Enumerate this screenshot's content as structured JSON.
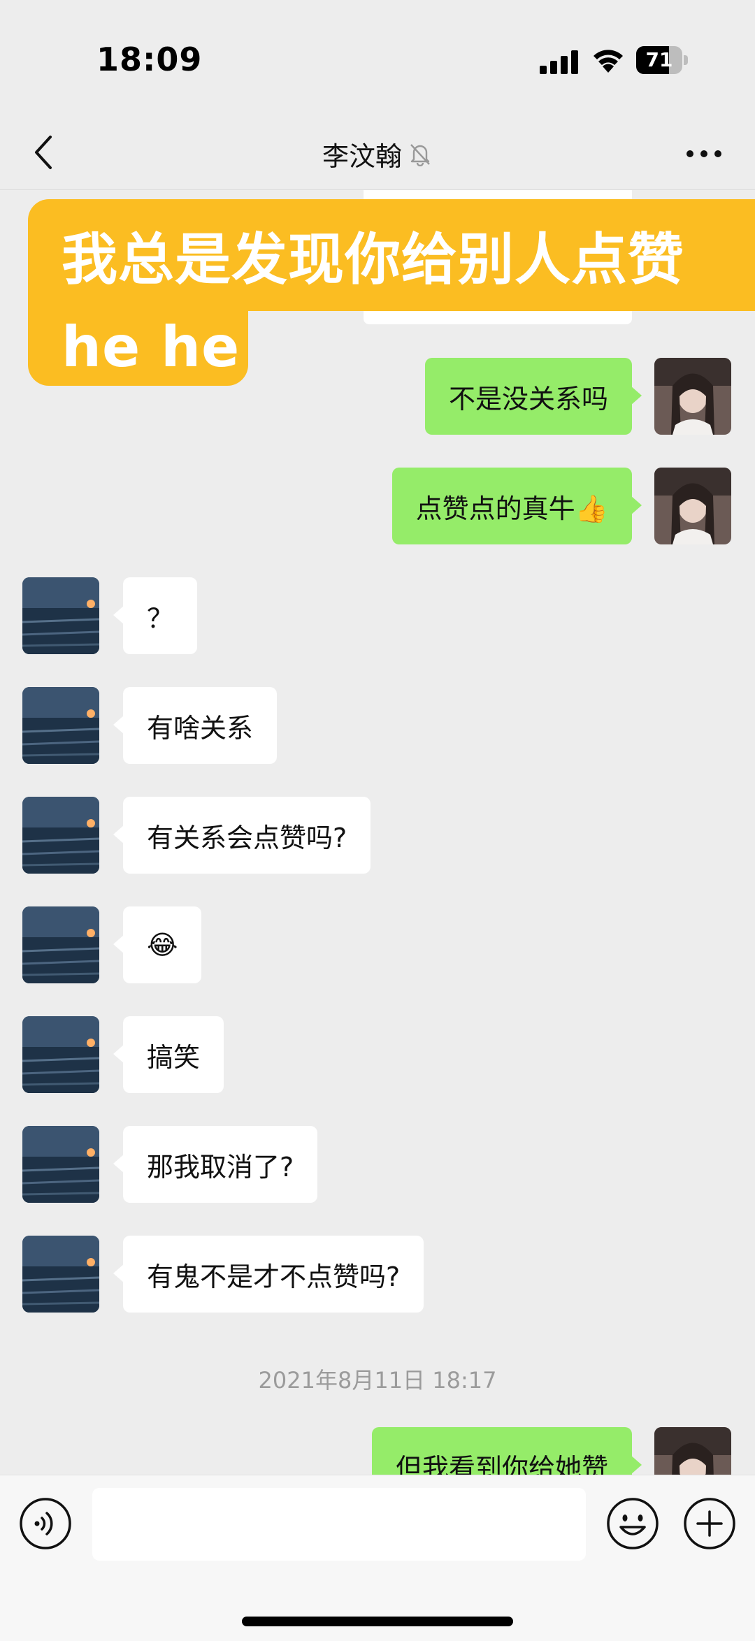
{
  "status_bar": {
    "time": "18:09",
    "battery": "71",
    "battery_level": 0.71
  },
  "header": {
    "title": "李汶翰",
    "back_icon": "chevron-left-icon",
    "mute_icon": "bell-off-icon",
    "more_icon": "more-dots-icon"
  },
  "caption": {
    "line1": "我总是发现你给别人点赞",
    "line2": "he he",
    "color": "#fbbd22"
  },
  "messages": [
    {
      "side": "right",
      "text": "不是没关系吗"
    },
    {
      "side": "right",
      "text": "点赞点的真牛👍"
    },
    {
      "side": "left",
      "text": "？"
    },
    {
      "side": "left",
      "text": "有啥关系"
    },
    {
      "side": "left",
      "text": "有关系会点赞吗?"
    },
    {
      "side": "left",
      "text": "😂"
    },
    {
      "side": "left",
      "text": "搞笑"
    },
    {
      "side": "left",
      "text": "那我取消了?"
    },
    {
      "side": "left",
      "text": "有鬼不是才不点赞吗?"
    },
    {
      "side": "right",
      "text": "但我看到你给她赞"
    }
  ],
  "timestamp": "2021年8月11日 18:17",
  "input_bar": {
    "voice_icon": "voice-icon",
    "emoji_icon": "emoji-icon",
    "plus_icon": "plus-circle-icon",
    "input_value": ""
  },
  "colors": {
    "background": "#ededed",
    "sent_bubble": "#95ec69",
    "received_bubble": "#ffffff"
  }
}
